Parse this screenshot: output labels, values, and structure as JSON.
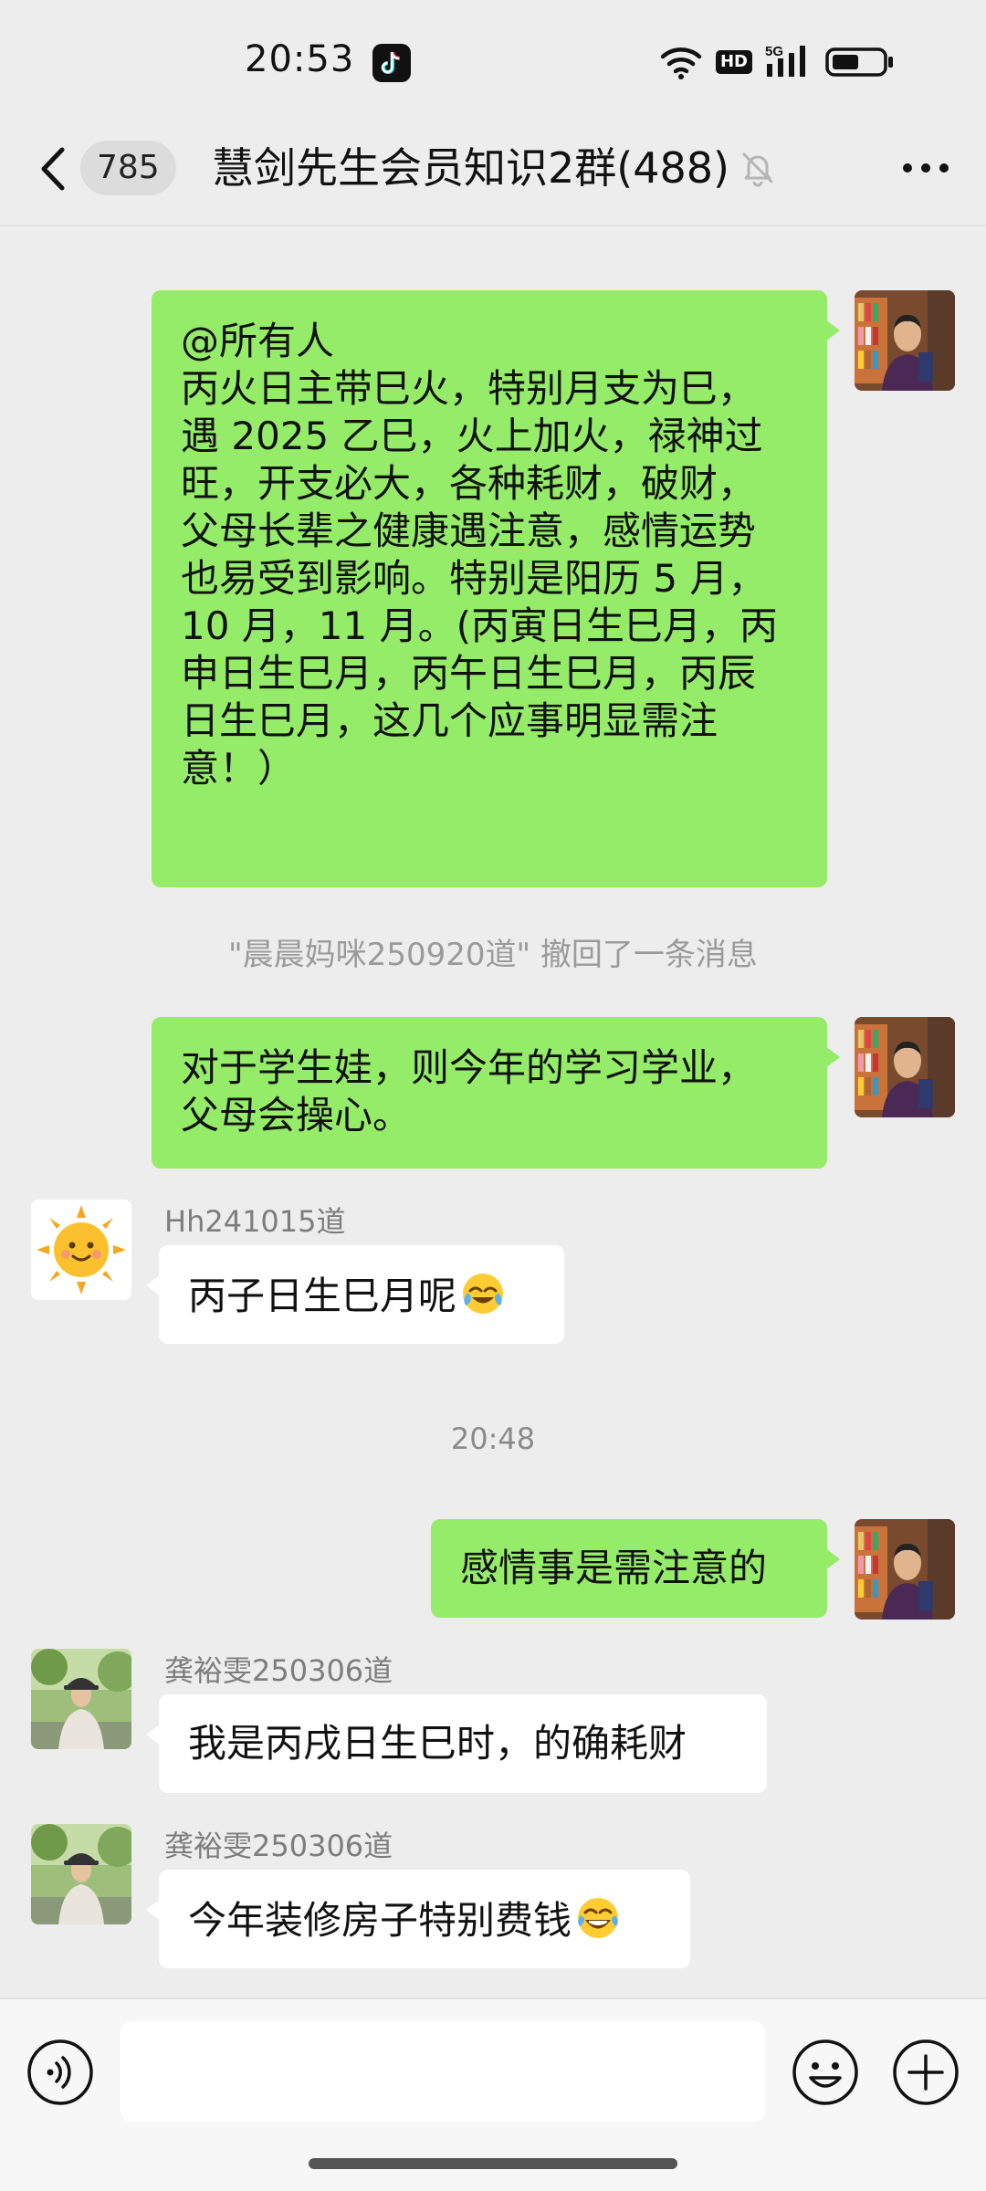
{
  "status_bar": {
    "time": "20:53",
    "network": "5G"
  },
  "header": {
    "unread_count": "785",
    "title": "慧剑先生会员知识2群(488)"
  },
  "messages": {
    "m1": {
      "lines": [
        "@所有人",
        "丙火日主带巳火，特别月支为巳，",
        "遇 2025 乙巳，火上加火，禄神过",
        "旺，开支必大，各种耗财，破财，",
        "父母长辈之健康遇注意，感情运势",
        "也易受到影响。特别是阳历 5 月，",
        "10 月，11 月。(丙寅日生巳月，丙",
        "申日生巳月，丙午日生巳月，丙辰",
        "日生巳月，这几个应事明显需注",
        "意！）"
      ]
    },
    "system_recall": "\"晨晨妈咪250920道\" 撤回了一条消息",
    "m2": {
      "lines": [
        "对于学生娃，则今年的学习学业，",
        "父母会操心。"
      ]
    },
    "m3": {
      "sender": "Hh241015道",
      "text": "丙子日生巳月呢"
    },
    "timestamp": "20:48",
    "m4": {
      "text": "感情事是需注意的"
    },
    "m5": {
      "sender": "龚裕雯250306道",
      "text": "我是丙戌日生巳时，的确耗财"
    },
    "m6": {
      "sender": "龚裕雯250306道",
      "text": "今年装修房子特别费钱"
    }
  },
  "input": {
    "value": "",
    "placeholder": ""
  },
  "icons": {
    "back": "chevron-left-icon",
    "mute": "bell-off-icon",
    "more": "ellipsis-icon",
    "voice": "voice-icon",
    "emoji": "smiley-icon",
    "plus": "plus-icon"
  },
  "colors": {
    "outgoing_bubble": "#95ec69",
    "incoming_bubble": "#ffffff",
    "background": "#ededed"
  }
}
